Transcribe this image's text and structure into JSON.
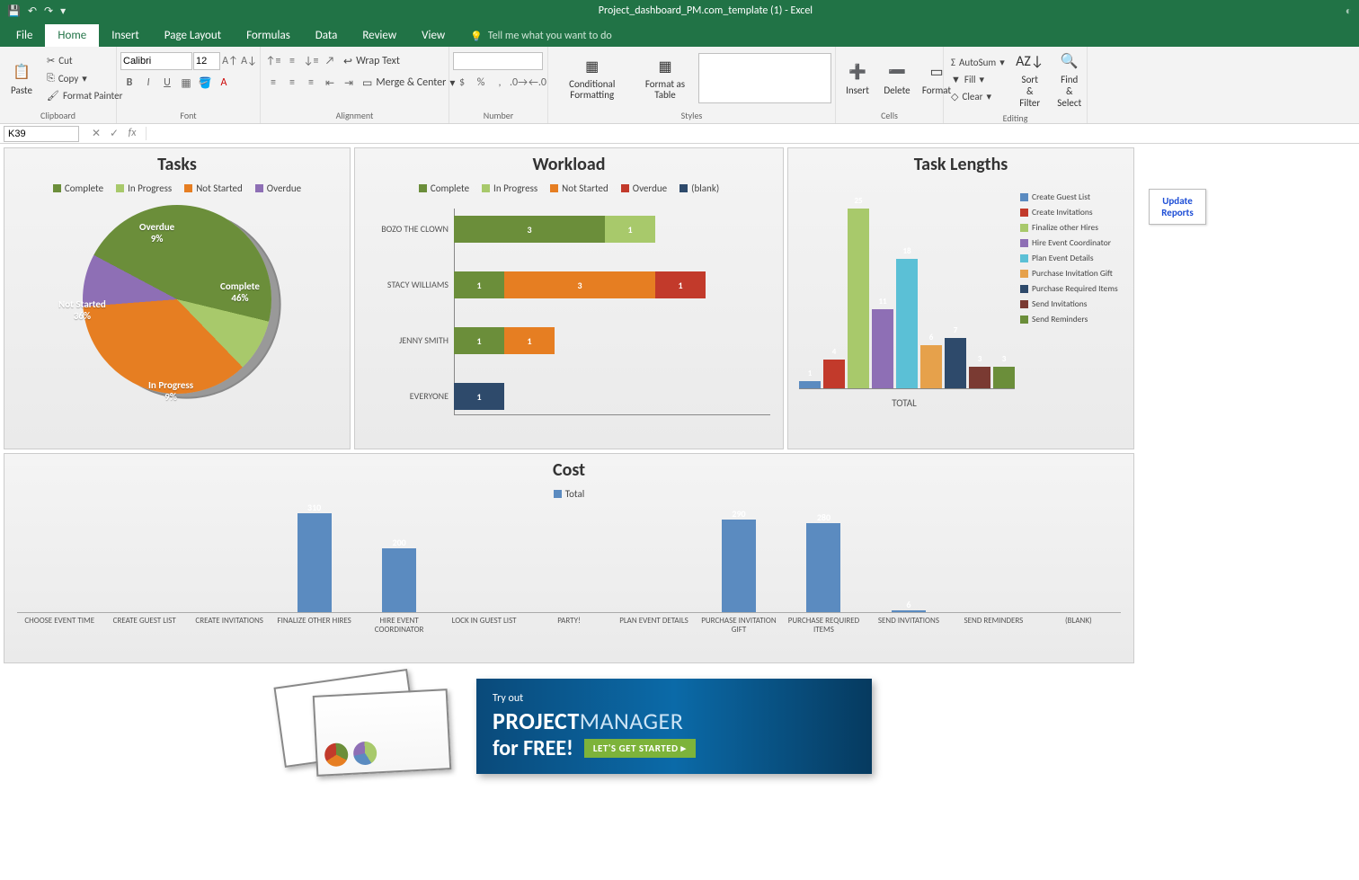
{
  "window": {
    "title": "Project_dashboard_PM.com_template (1) - Excel"
  },
  "tabs": [
    "File",
    "Home",
    "Insert",
    "Page Layout",
    "Formulas",
    "Data",
    "Review",
    "View"
  ],
  "active_tab": "Home",
  "tellme": "Tell me what you want to do",
  "ribbon": {
    "clipboard": {
      "label": "Clipboard",
      "paste": "Paste",
      "cut": "Cut",
      "copy": "Copy",
      "format_painter": "Format Painter"
    },
    "font": {
      "label": "Font",
      "name": "Calibri",
      "size": "12",
      "bold": "B",
      "italic": "I",
      "underline": "U"
    },
    "alignment": {
      "label": "Alignment",
      "wrap": "Wrap Text",
      "merge": "Merge & Center"
    },
    "number": {
      "label": "Number"
    },
    "styles": {
      "label": "Styles",
      "cond": "Conditional Formatting",
      "table": "Format as Table"
    },
    "cells": {
      "label": "Cells",
      "insert": "Insert",
      "delete": "Delete",
      "format": "Format"
    },
    "editing": {
      "label": "Editing",
      "autosum": "AutoSum",
      "fill": "Fill",
      "clear": "Clear",
      "sort": "Sort & Filter",
      "find": "Find & Select"
    }
  },
  "namebox": "K39",
  "update_reports": "Update Reports",
  "chart_data": {
    "tasks_pie": {
      "type": "pie",
      "title": "Tasks",
      "legend": [
        "Complete",
        "In Progress",
        "Not Started",
        "Overdue"
      ],
      "colors": {
        "Complete": "#6b8e3a",
        "In Progress": "#a8c96b",
        "Not Started": "#e67e22",
        "Overdue": "#8e6fb5"
      },
      "slices": [
        {
          "label": "Complete",
          "pct": 46
        },
        {
          "label": "In Progress",
          "pct": 9
        },
        {
          "label": "Not Started",
          "pct": 36
        },
        {
          "label": "Overdue",
          "pct": 9
        }
      ]
    },
    "workload": {
      "type": "bar",
      "title": "Workload",
      "legend": [
        "Complete",
        "In Progress",
        "Not Started",
        "Overdue",
        "(blank)"
      ],
      "colors": {
        "Complete": "#6b8e3a",
        "In Progress": "#a8c96b",
        "Not Started": "#e67e22",
        "Overdue": "#c23a2b",
        "(blank)": "#2e4a6b"
      },
      "rows": [
        {
          "name": "BOZO THE CLOWN",
          "segments": [
            {
              "series": "Complete",
              "value": 3
            },
            {
              "series": "In Progress",
              "value": 1
            }
          ]
        },
        {
          "name": "STACY WILLIAMS",
          "segments": [
            {
              "series": "Complete",
              "value": 1
            },
            {
              "series": "Not Started",
              "value": 3
            },
            {
              "series": "Overdue",
              "value": 1
            }
          ]
        },
        {
          "name": "JENNY SMITH",
          "segments": [
            {
              "series": "Complete",
              "value": 1
            },
            {
              "series": "Not Started",
              "value": 1
            }
          ]
        },
        {
          "name": "EVERYONE",
          "segments": [
            {
              "series": "(blank)",
              "value": 1
            }
          ]
        }
      ]
    },
    "task_lengths": {
      "type": "bar",
      "title": "Task Lengths",
      "xlabel": "TOTAL",
      "series": [
        {
          "name": "Create Guest List",
          "color": "#5b8bc0",
          "value": 1
        },
        {
          "name": "Create Invitations",
          "color": "#c23a2b",
          "value": 4
        },
        {
          "name": "Finalize other Hires",
          "color": "#a8c96b",
          "value": 25
        },
        {
          "name": "Hire Event Coordinator",
          "color": "#8e6fb5",
          "value": 11
        },
        {
          "name": "Plan Event Details",
          "color": "#5bc0d6",
          "value": 18
        },
        {
          "name": "Purchase Invitation Gift",
          "color": "#e6a14b",
          "value": 6
        },
        {
          "name": "Purchase Required Items",
          "color": "#2e4a6b",
          "value": 7
        },
        {
          "name": "Send Invitations",
          "color": "#7a3a32",
          "value": 3
        },
        {
          "name": "Send Reminders",
          "color": "#6b8e3a",
          "value": 3
        }
      ]
    },
    "cost": {
      "type": "bar",
      "title": "Cost",
      "legend": [
        "Total"
      ],
      "color": "#5b8bc0",
      "categories": [
        "CHOOSE EVENT TIME",
        "CREATE GUEST LIST",
        "CREATE INVITATIONS",
        "FINALIZE OTHER HIRES",
        "HIRE EVENT COORDINATOR",
        "LOCK IN GUEST LIST",
        "PARTY!",
        "PLAN EVENT DETAILS",
        "PURCHASE INVITATION GIFT",
        "PURCHASE REQUIRED ITEMS",
        "SEND INVITATIONS",
        "SEND REMINDERS",
        "(BLANK)"
      ],
      "values": [
        0,
        0,
        0,
        310,
        200,
        0,
        0,
        0,
        290,
        280,
        6,
        0,
        0
      ]
    }
  },
  "ad": {
    "try": "Try out",
    "brand1": "PROJECT",
    "brand2": "MANAGER",
    "free": "for FREE!",
    "cta": "LET'S GET STARTED ▸"
  }
}
